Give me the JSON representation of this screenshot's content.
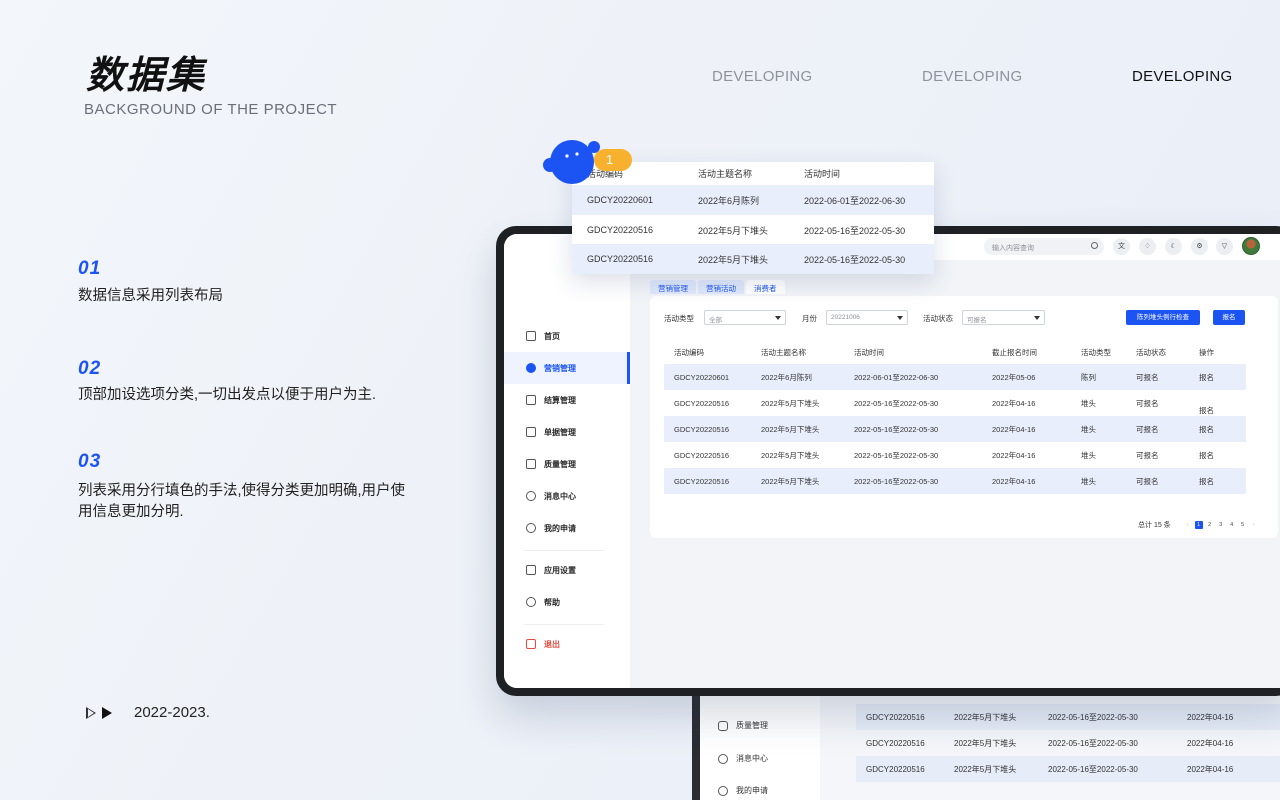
{
  "header": {
    "title": "数据集",
    "subtitle": "BACKGROUND OF THE PROJECT",
    "nav": [
      "DEVELOPING",
      "DEVELOPING",
      "DEVELOPING"
    ]
  },
  "points": [
    {
      "no": "01",
      "text": "数据信息采用列表布局"
    },
    {
      "no": "02",
      "text": "顶部加设选项分类,一切出发点以便于用户为主."
    },
    {
      "no": "03",
      "text": "列表采用分行填色的手法,使得分类更加明确,用户使用信息更加分明."
    }
  ],
  "footer": {
    "years": "2022-2023."
  },
  "floating": {
    "badge": "1",
    "headers": [
      "活动编码",
      "活动主题名称",
      "活动时间"
    ],
    "rows": [
      [
        "GDCY20220601",
        "2022年6月陈列",
        "2022-06-01至2022-06-30"
      ],
      [
        "GDCY20220516",
        "2022年5月下堆头",
        "2022-05-16至2022-05-30"
      ],
      [
        "GDCY20220516",
        "2022年5月下堆头",
        "2022-05-16至2022-05-30"
      ]
    ]
  },
  "app": {
    "search_placeholder": "输入内容查询",
    "topbar_icons": [
      "translate-icon",
      "bell-icon",
      "moon-icon",
      "settings-icon",
      "shirt-icon"
    ],
    "sidebar": [
      {
        "label": "首页",
        "icon": "home-icon"
      },
      {
        "label": "营销管理",
        "icon": "pie-chart-icon"
      },
      {
        "label": "结算管理",
        "icon": "bar-chart-icon"
      },
      {
        "label": "单据管理",
        "icon": "document-icon"
      },
      {
        "label": "质量管理",
        "icon": "quality-icon"
      },
      {
        "label": "消息中心",
        "icon": "message-icon"
      },
      {
        "label": "我的申请",
        "icon": "user-icon"
      },
      {
        "label": "应用设置",
        "icon": "apps-icon"
      },
      {
        "label": "帮助",
        "icon": "help-icon"
      },
      {
        "label": "退出",
        "icon": "logout-icon"
      }
    ],
    "tabs": [
      "营销管理",
      "营销活动",
      "消费者"
    ],
    "filters": {
      "type_label": "活动类型",
      "type_value": "全部",
      "month_label": "月份",
      "month_value": "20221006",
      "status_label": "活动状态",
      "status_value": "可报名",
      "check_button": "陈列堆头例行检查",
      "signup_button": "报名"
    },
    "table": {
      "headers": [
        "活动编码",
        "活动主题名称",
        "活动时间",
        "截止报名时间",
        "活动类型",
        "活动状态",
        "操作"
      ],
      "rows": [
        [
          "GDCY20220601",
          "2022年6月陈列",
          "2022-06-01至2022-06-30",
          "2022年05-06",
          "陈列",
          "可报名",
          "报名"
        ],
        [
          "GDCY20220516",
          "2022年5月下堆头",
          "2022-05-16至2022-05-30",
          "2022年04-16",
          "堆头",
          "可报名",
          "报名"
        ],
        [
          "GDCY20220516",
          "2022年5月下堆头",
          "2022-05-16至2022-05-30",
          "2022年04-16",
          "堆头",
          "可报名",
          "报名"
        ],
        [
          "GDCY20220516",
          "2022年5月下堆头",
          "2022-05-16至2022-05-30",
          "2022年04-16",
          "堆头",
          "可报名",
          "报名"
        ],
        [
          "GDCY20220516",
          "2022年5月下堆头",
          "2022-05-16至2022-05-30",
          "2022年04-16",
          "堆头",
          "可报名",
          "报名"
        ]
      ]
    },
    "pagination": {
      "total": "总计 15 条",
      "pages": [
        "1",
        "2",
        "3",
        "4",
        "5"
      ]
    }
  },
  "back_app": {
    "sidebar": [
      "质量管理",
      "消息中心",
      "我的申请"
    ],
    "rows": [
      [
        "GDCY20220516",
        "2022年5月下堆头",
        "2022-05-16至2022-05-30",
        "2022年04-16"
      ],
      [
        "GDCY20220516",
        "2022年5月下堆头",
        "2022-05-16至2022-05-30",
        "2022年04-16"
      ],
      [
        "GDCY20220516",
        "2022年5月下堆头",
        "2022-05-16至2022-05-30",
        "2022年04-16"
      ]
    ]
  },
  "colors": {
    "accent": "#1c54f4",
    "badge": "#f8b12f",
    "row_fill": "#e8eefb",
    "danger": "#e64a3f"
  }
}
